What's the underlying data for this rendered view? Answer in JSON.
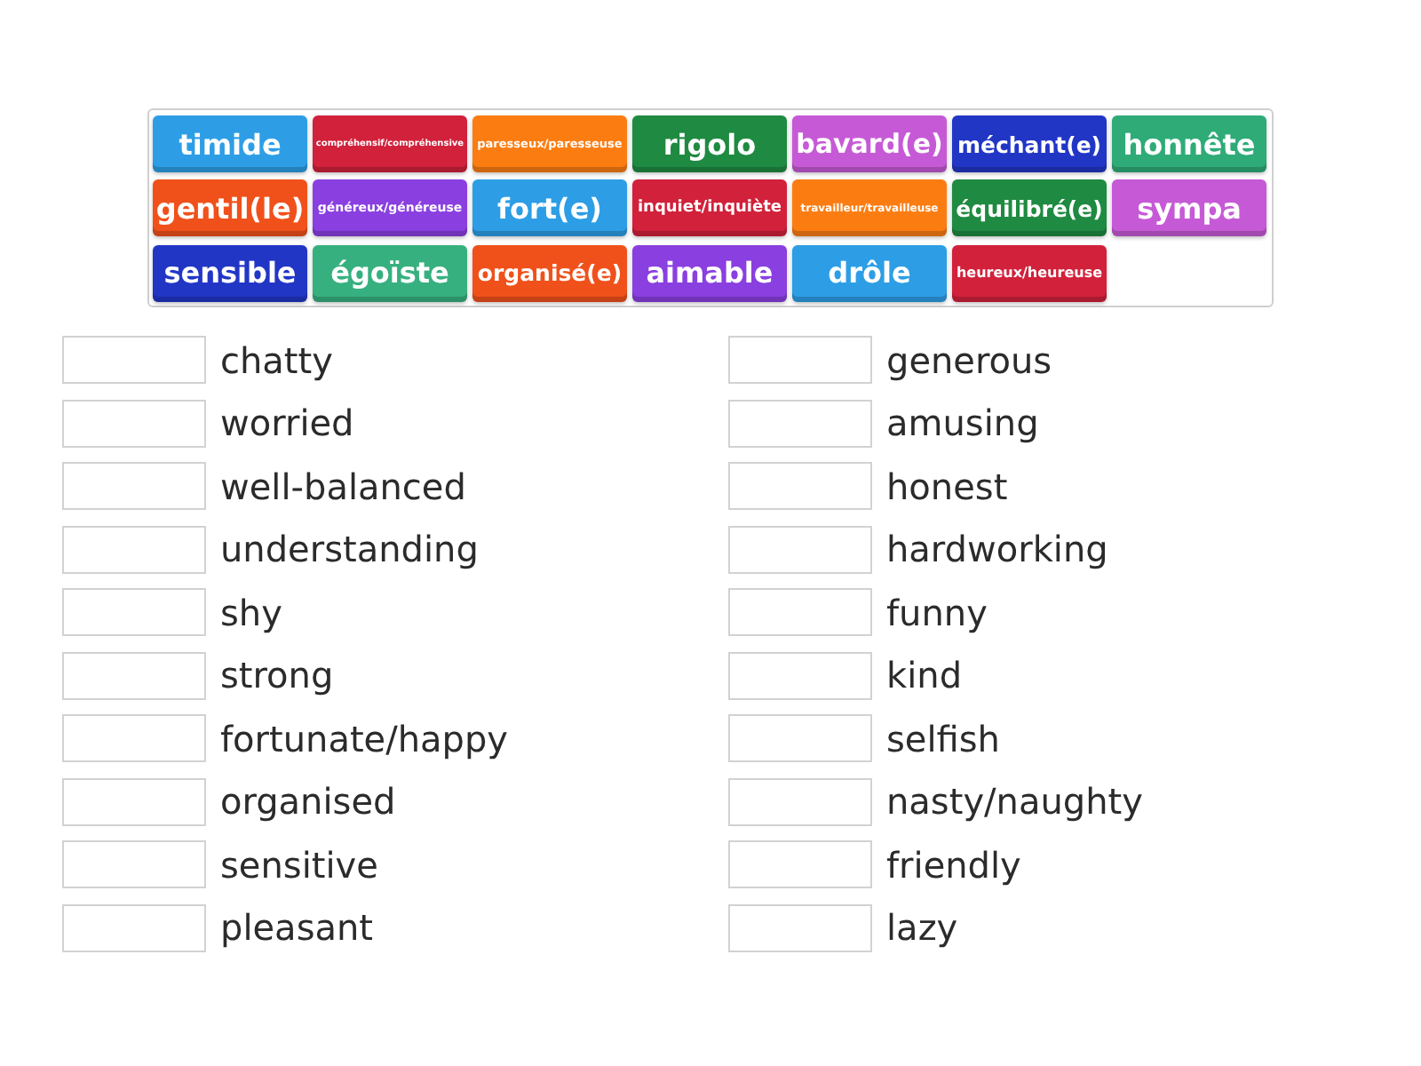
{
  "tiles": [
    {
      "label": "timide",
      "color": "#2d9ee6"
    },
    {
      "label": "compréhensif/compréhensive",
      "color": "#d1213b"
    },
    {
      "label": "paresseux/paresseuse",
      "color": "#fb7d12"
    },
    {
      "label": "rigolo",
      "color": "#1f8a41"
    },
    {
      "label": "bavard(e)",
      "color": "#c65ad6"
    },
    {
      "label": "méchant(e)",
      "color": "#2236c6"
    },
    {
      "label": "honnête",
      "color": "#2fab78"
    },
    {
      "label": "gentil(le)",
      "color": "#f0511b"
    },
    {
      "label": "généreux/généreuse",
      "color": "#8a3fe0"
    },
    {
      "label": "fort(e)",
      "color": "#2d9ee6"
    },
    {
      "label": "inquiet/inquiète",
      "color": "#d1213b"
    },
    {
      "label": "travailleur/travailleuse",
      "color": "#fb7d12"
    },
    {
      "label": "équilibré(e)",
      "color": "#1f8a41"
    },
    {
      "label": "sympa",
      "color": "#c65ad6"
    },
    {
      "label": "sensible",
      "color": "#2236c6"
    },
    {
      "label": "égoïste",
      "color": "#37b07f"
    },
    {
      "label": "organisé(e)",
      "color": "#f0511b"
    },
    {
      "label": "aimable",
      "color": "#8a3fe0"
    },
    {
      "label": "drôle",
      "color": "#2d9ee6"
    },
    {
      "label": "heureux/heureuse",
      "color": "#d1213b"
    }
  ],
  "prompt_columns": [
    {
      "prompts": [
        "chatty",
        "worried",
        "well-balanced",
        "understanding",
        "shy",
        "strong",
        "fortunate/happy",
        "organised",
        "sensitive",
        "pleasant"
      ]
    },
    {
      "prompts": [
        "generous",
        "amusing",
        "honest",
        "hardworking",
        "funny",
        "kind",
        "selfish",
        "nasty/naughty",
        "friendly",
        "lazy"
      ]
    }
  ]
}
